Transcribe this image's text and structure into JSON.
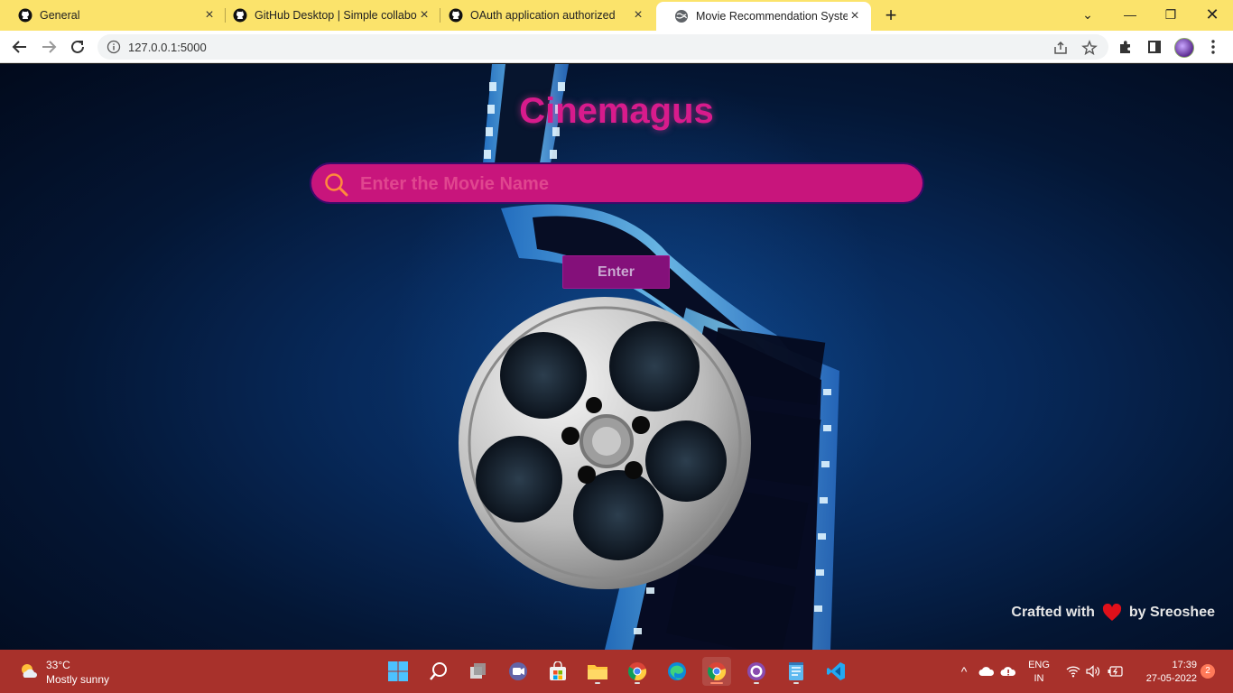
{
  "browser": {
    "tabs": [
      {
        "title": "General",
        "icon": "github-icon",
        "active": false
      },
      {
        "title": "GitHub Desktop | Simple collabo",
        "icon": "github-icon",
        "active": false
      },
      {
        "title": "OAuth application authorized",
        "icon": "github-icon",
        "active": false
      },
      {
        "title": "Movie Recommendation System",
        "icon": "globe-icon",
        "active": true
      }
    ],
    "url": "127.0.0.1:5000"
  },
  "page": {
    "title": "Cinemagus",
    "search_placeholder": "Enter the Movie Name",
    "enter_label": "Enter",
    "footer_prefix": "Crafted with",
    "footer_suffix": "by Sreoshee",
    "colors": {
      "accent": "#c8157c",
      "title": "#d81b8c",
      "button": "#84107a",
      "heart": "#e0101a"
    }
  },
  "taskbar": {
    "weather_temp": "33°C",
    "weather_desc": "Mostly sunny",
    "language_line1": "ENG",
    "language_line2": "IN",
    "time": "17:39",
    "date": "27-05-2022",
    "notification_count": "2"
  }
}
